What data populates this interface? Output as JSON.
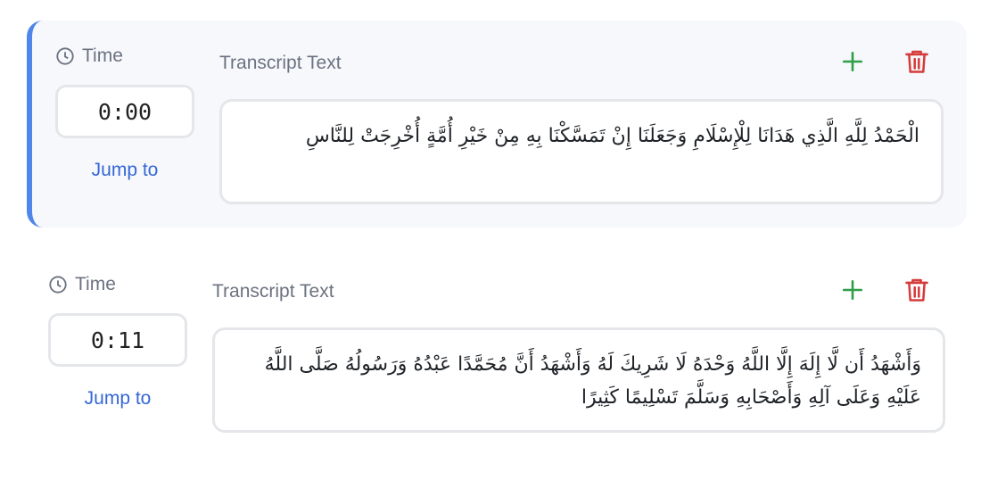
{
  "colors": {
    "accent_bar": "#4f86ec",
    "link": "#3567d6",
    "add_icon": "#2e9e48",
    "delete_icon": "#d63b3b"
  },
  "segments": [
    {
      "active": true,
      "time_label": "Time",
      "time_value": "0:00",
      "jump_label": "Jump to",
      "transcript_label": "Transcript Text",
      "text": "الْحَمْدُ لِلَّهِ الَّذِي هَدَانَا لِلْإِسْلَامِ وَجَعَلَنَا إِنْ تَمَسَّكْنَا بِهِ مِنْ خَيْرِ أُمَّةٍ أُخْرِجَتْ لِلنَّاسِ",
      "icons": {
        "clock": "clock-icon",
        "add": "plus-icon",
        "delete": "trash-icon"
      }
    },
    {
      "active": false,
      "time_label": "Time",
      "time_value": "0:11",
      "jump_label": "Jump to",
      "transcript_label": "Transcript Text",
      "text": "وَأَشْهَدُ أَن لَّا إِلَهَ إِلَّا اللَّهُ وَحْدَهُ لَا شَرِيكَ لَهُ وَأَشْهَدُ أَنَّ مُحَمَّدًا عَبْدُهُ وَرَسُولُهُ صَلَّى اللَّهُ عَلَيْهِ وَعَلَى آلِهِ وَأَصْحَابِهِ وَسَلَّمَ تَسْلِيمًا كَثِيرًا",
      "icons": {
        "clock": "clock-icon",
        "add": "plus-icon",
        "delete": "trash-icon"
      }
    }
  ]
}
